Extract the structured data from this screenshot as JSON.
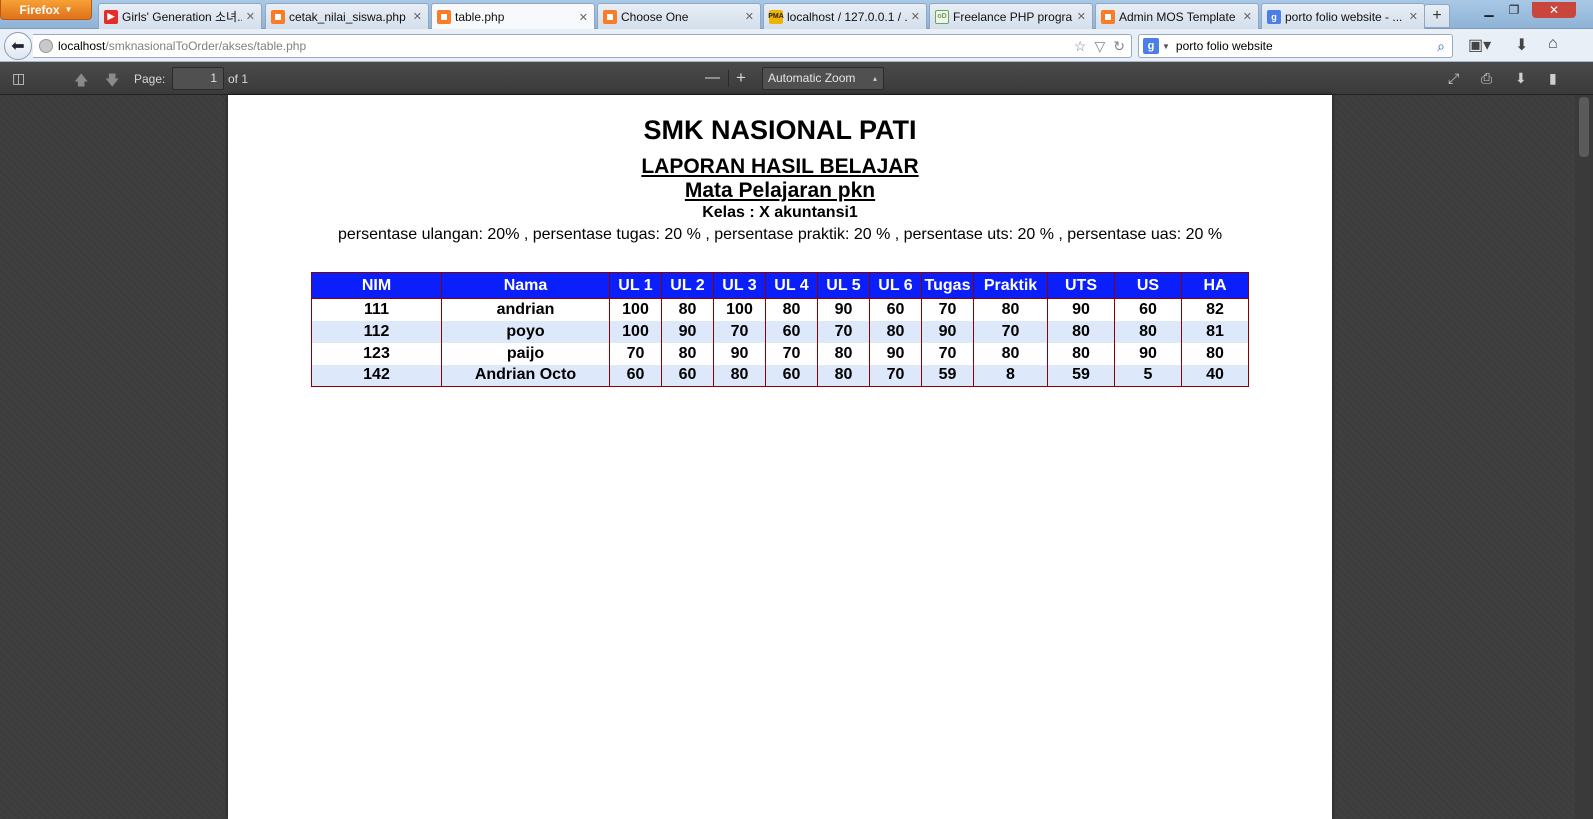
{
  "browser": {
    "app_button_label": "Firefox",
    "tabs": [
      {
        "title": "Girls' Generation 소녀...",
        "icon": "youtube-icon"
      },
      {
        "title": "cetak_nilai_siswa.php",
        "icon": "xampp-icon"
      },
      {
        "title": "table.php",
        "icon": "xampp-icon",
        "active": true
      },
      {
        "title": "Choose One",
        "icon": "xampp-icon"
      },
      {
        "title": "localhost / 127.0.0.1 / ...",
        "icon": "phpmyadmin-icon"
      },
      {
        "title": "Freelance PHP progra...",
        "icon": "odesk-icon"
      },
      {
        "title": "Admin MOS Template",
        "icon": "xampp-icon"
      },
      {
        "title": "porto folio website - ...",
        "icon": "google-icon"
      }
    ],
    "url_host": "localhost",
    "url_path": "/smknasionalToOrder/akses/table.php",
    "search_engine_badge": "g",
    "search_text": "porto folio website"
  },
  "pdf_toolbar": {
    "page_label": "Page:",
    "page_value": "1",
    "page_total": "of 1",
    "zoom_out": "—",
    "zoom_in": "+",
    "zoom_value": "Automatic Zoom"
  },
  "document": {
    "title": "SMK NASIONAL PATI",
    "subtitle": "LAPORAN HASIL BELAJAR",
    "subject": "Mata Pelajaran pkn",
    "class_line": "Kelas : X akuntansi1",
    "percentages": "persentase ulangan: 20% , persentase tugas: 20 % , persentase praktik: 20 % , persentase uts: 20 % , persentase uas: 20 %",
    "table": {
      "headers": [
        "NIM",
        "Nama",
        "UL 1",
        "UL 2",
        "UL 3",
        "UL 4",
        "UL 5",
        "UL 6",
        "Tugas",
        "Praktik",
        "UTS",
        "US",
        "HA"
      ],
      "rows": [
        [
          "111",
          "andrian",
          "100",
          "80",
          "100",
          "80",
          "90",
          "60",
          "70",
          "80",
          "90",
          "60",
          "82"
        ],
        [
          "112",
          "poyo",
          "100",
          "90",
          "70",
          "60",
          "70",
          "80",
          "90",
          "70",
          "80",
          "80",
          "81"
        ],
        [
          "123",
          "paijo",
          "70",
          "80",
          "90",
          "70",
          "80",
          "90",
          "70",
          "80",
          "80",
          "90",
          "80"
        ],
        [
          "142",
          "Andrian Octo",
          "60",
          "60",
          "80",
          "60",
          "80",
          "70",
          "59",
          "8",
          "59",
          "5",
          "40"
        ]
      ]
    }
  },
  "colors": {
    "table_header_bg": "#0a1ffc",
    "table_border": "#8b0000",
    "row_alt_bg": "#dde8fa"
  }
}
